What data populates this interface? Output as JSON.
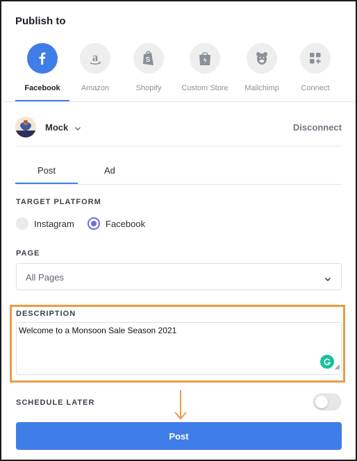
{
  "header": {
    "title": "Publish to"
  },
  "platforms": [
    {
      "label": "Facebook",
      "icon": "facebook-icon",
      "active": true
    },
    {
      "label": "Amazon",
      "icon": "amazon-icon",
      "active": false
    },
    {
      "label": "Shopify",
      "icon": "shopify-icon",
      "active": false
    },
    {
      "label": "Custom Store",
      "icon": "store-bolt-icon",
      "active": false
    },
    {
      "label": "Mailchimp",
      "icon": "mailchimp-icon",
      "active": false
    },
    {
      "label": "Connect",
      "icon": "add-apps-icon",
      "active": false
    }
  ],
  "account": {
    "name": "Mock",
    "disconnect_label": "Disconnect"
  },
  "tabs": {
    "post": "Post",
    "ad": "Ad",
    "active": "Post"
  },
  "target_platform": {
    "label": "TARGET PLATFORM",
    "options": [
      "Instagram",
      "Facebook"
    ],
    "selected": "Facebook"
  },
  "page": {
    "label": "PAGE",
    "value": "All Pages"
  },
  "description": {
    "label": "DESCRIPTION",
    "value": "Welcome to a Monsoon Sale Season 2021"
  },
  "schedule": {
    "label": "SCHEDULE LATER",
    "enabled": false
  },
  "actions": {
    "post_label": "Post"
  },
  "colors": {
    "accent": "#3f7de8",
    "highlight": "#ec9a45",
    "radio": "#6a6de3",
    "grammarly": "#15c39a"
  }
}
